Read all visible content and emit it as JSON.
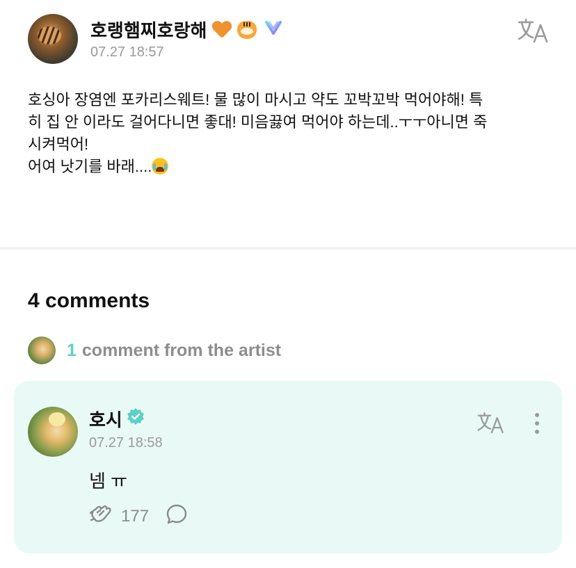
{
  "post": {
    "author_name": "호랭햄찌호랑해",
    "author_emojis": [
      "orange-heart",
      "tiger-face",
      "weverse-bubble"
    ],
    "timestamp": "07.27 18:57",
    "body": "호싱아 장염엔 포카리스웨트! 물 많이 마시고 약도 꼬박꼬박 먹어야해! 특\n히 집 안 이라도 걸어다니면 좋대! 미음끓여 먹어야 하는데..ㅜㅜ아니면 죽\n시켜먹어!\n어여 낫기를 바래....",
    "body_trailing_emoji": "loudly-crying-face"
  },
  "comments": {
    "title": "4 comments",
    "artist_count": "1",
    "artist_text": "comment from the artist",
    "items": [
      {
        "author_name": "호시",
        "verified": true,
        "timestamp": "07.27 18:58",
        "text": "넴 ㅠ",
        "like_count": "177"
      }
    ]
  },
  "icons": {
    "translate": "translate-icon",
    "more": "more-vertical-icon",
    "like": "cheer-hands-icon",
    "reply": "reply-bubble-icon",
    "verified": "verified-badge-icon"
  },
  "colors": {
    "accent": "#5ad1c4",
    "card_background": "#e9faf6",
    "muted_text": "#9a9a9a",
    "orange_heart": "#f0922e"
  }
}
